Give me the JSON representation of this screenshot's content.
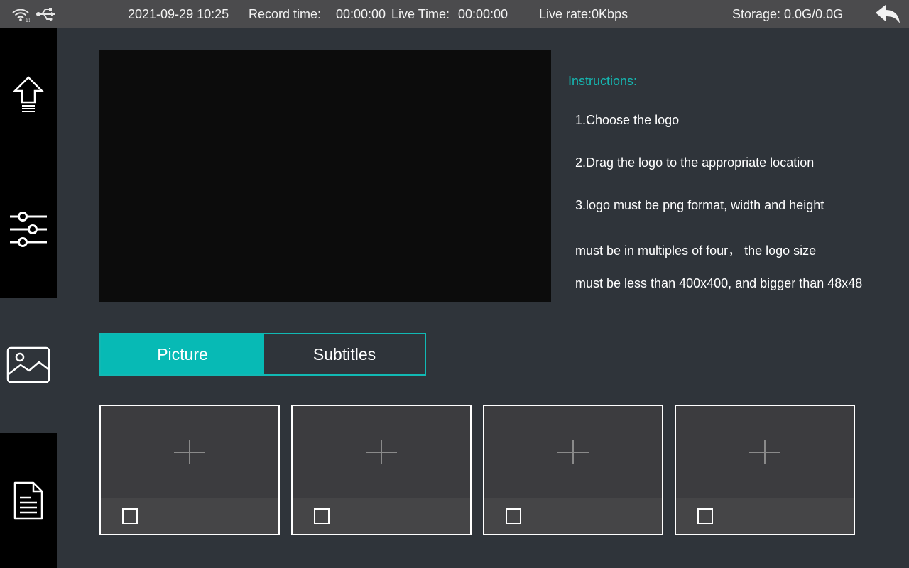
{
  "status_bar": {
    "datetime": "2021-09-29 10:25",
    "record_label": "Record time:",
    "record_value": "00:00:00",
    "live_label": "Live Time:",
    "live_value": "00:00:00",
    "live_rate": "Live rate:0Kbps",
    "storage": "Storage: 0.0G/0.0G",
    "icons": [
      "wifi-icon",
      "usb-icon",
      "back-arrow-icon"
    ]
  },
  "sidebar": {
    "items": [
      {
        "name": "upload",
        "icon": "upload-arrow-icon",
        "active": false
      },
      {
        "name": "settings",
        "icon": "sliders-icon",
        "active": false
      },
      {
        "name": "logo",
        "icon": "image-icon",
        "active": true
      },
      {
        "name": "document",
        "icon": "document-icon",
        "active": false
      }
    ]
  },
  "instructions": {
    "title": "Instructions:",
    "lines": [
      "1.Choose the logo",
      "2.Drag the logo to the appropriate location",
      "3.logo must be png format, width and height",
      "must be in multiples of four， the logo size",
      "must be less than 400x400, and bigger than 48x48"
    ]
  },
  "tabs": [
    {
      "label": "Picture",
      "active": true
    },
    {
      "label": "Subtitles",
      "active": false
    }
  ],
  "logo_slots": [
    {
      "icon": "plus-icon",
      "checked": false
    },
    {
      "icon": "plus-icon",
      "checked": false
    },
    {
      "icon": "plus-icon",
      "checked": false
    },
    {
      "icon": "plus-icon",
      "checked": false
    }
  ],
  "colors": {
    "accent": "#07bab5",
    "topbar": "#4b4b4d",
    "background": "#2f343a",
    "sidebar": "#000000"
  }
}
